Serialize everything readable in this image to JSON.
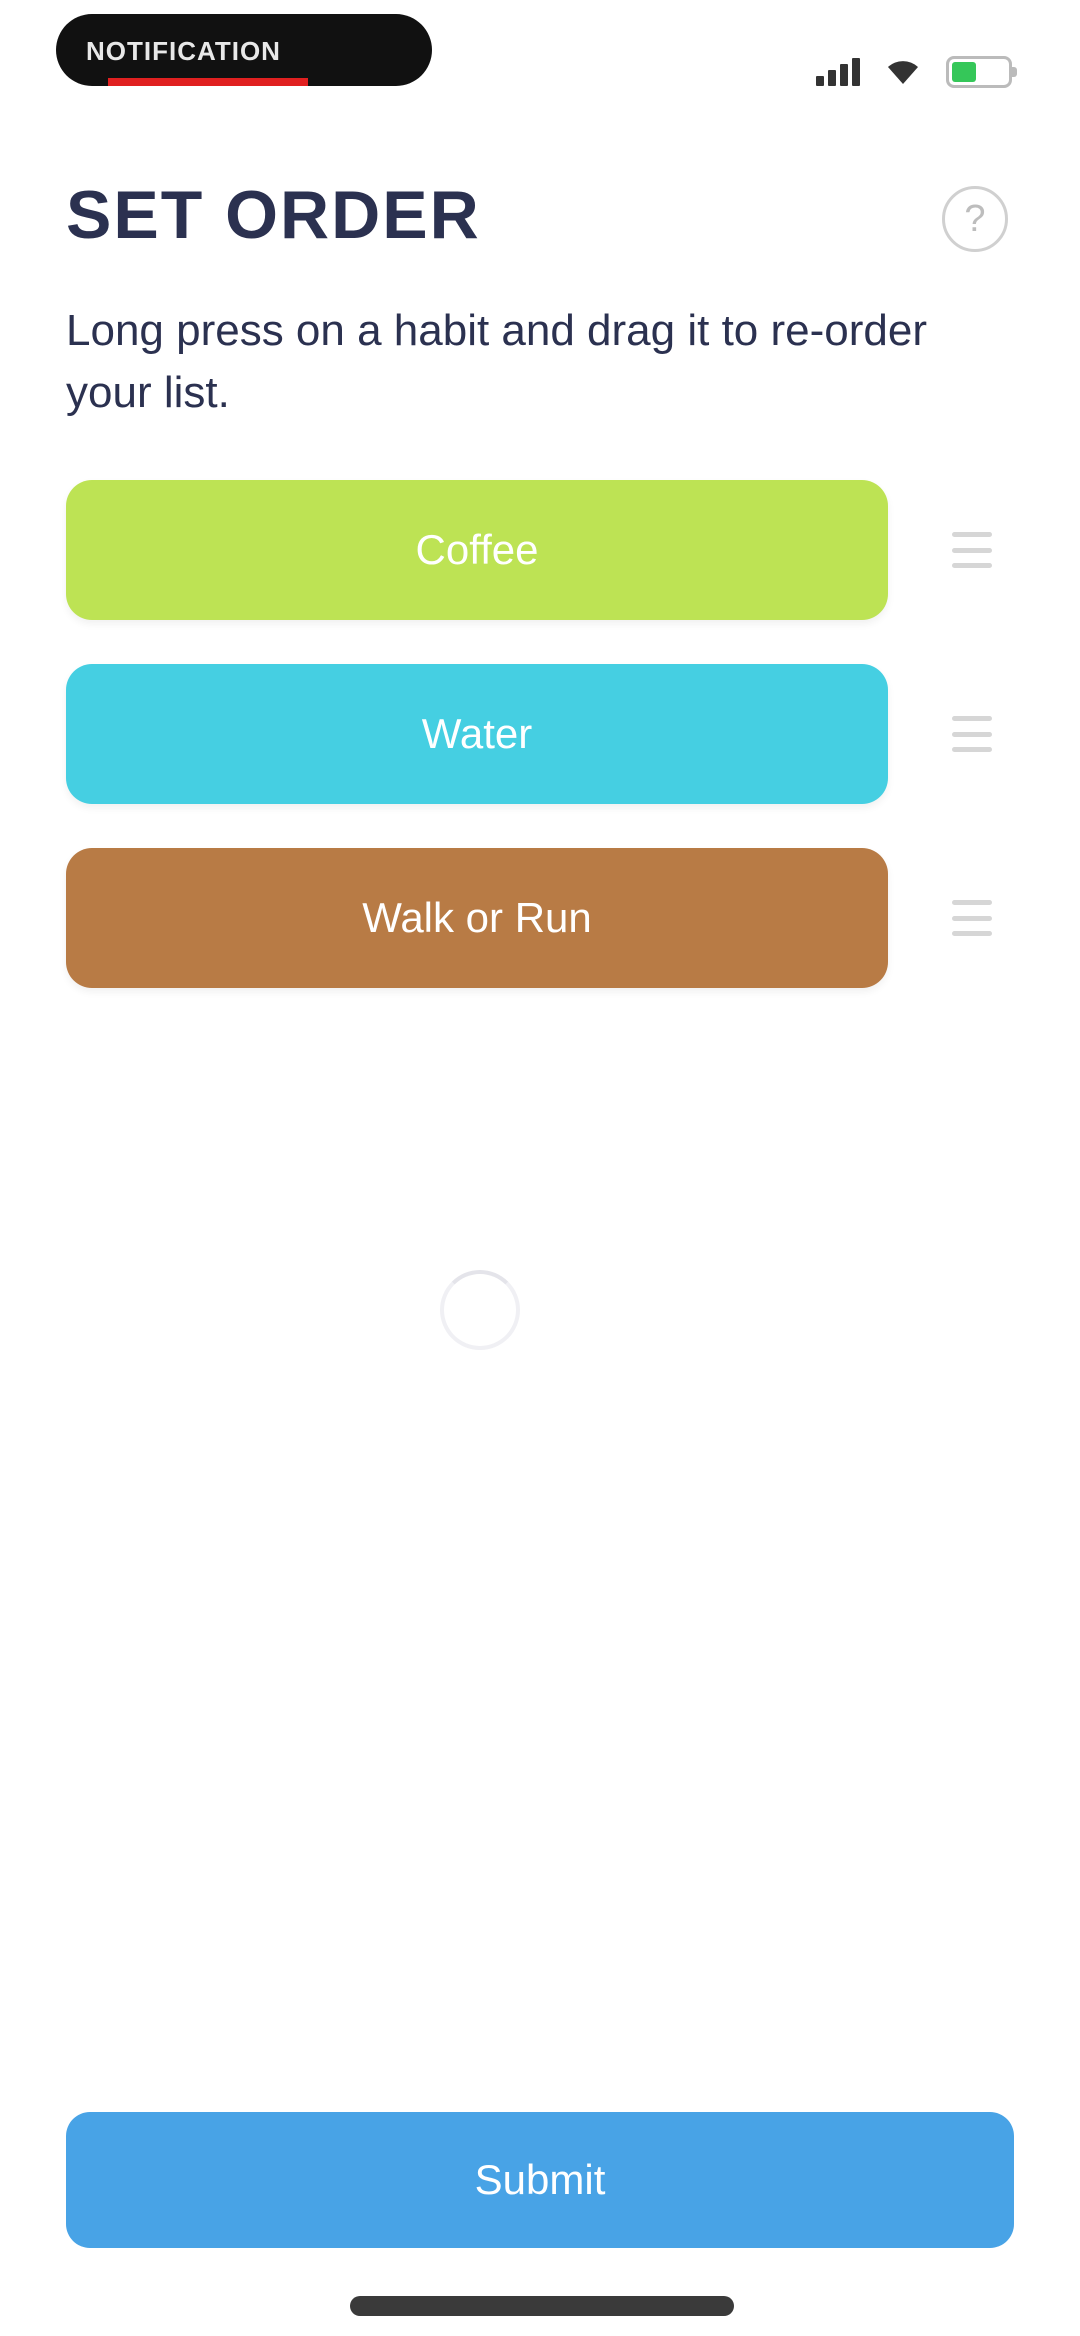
{
  "status_bar": {
    "recording_label": "NOTIFICATION",
    "colors": {
      "battery": "#35c759",
      "recording": "#e02020"
    }
  },
  "header": {
    "title": "SET ORDER",
    "help_glyph": "?",
    "instructions": "Long press on a habit and drag it to re-order your list."
  },
  "habits": [
    {
      "label": "Coffee",
      "color": "#bde354"
    },
    {
      "label": "Water",
      "color": "#45cfe2"
    },
    {
      "label": "Walk or Run",
      "color": "#b87b45"
    }
  ],
  "footer": {
    "submit_label": "Submit",
    "color": "#48a3e6"
  },
  "icons": [
    "help-icon",
    "drag-handle-icon",
    "signal-icon",
    "wifi-icon",
    "battery-icon",
    "loading-spinner"
  ]
}
